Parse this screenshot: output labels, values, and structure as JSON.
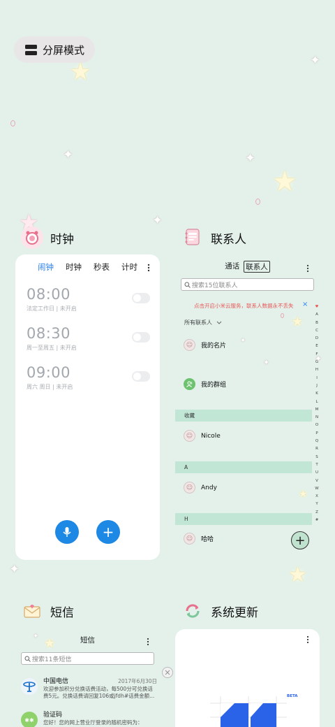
{
  "split_screen": {
    "label": "分屏模式"
  },
  "clock": {
    "app_title": "时钟",
    "tabs": [
      "闹钟",
      "时钟",
      "秒表",
      "计时"
    ],
    "alarms": [
      {
        "time": "08:00",
        "sub": "法定工作日 | 未开启"
      },
      {
        "time": "08:30",
        "sub": "周一至周五 | 未开启"
      },
      {
        "time": "09:00",
        "sub": "周六 周日 | 未开启"
      }
    ],
    "add_symbol": "+"
  },
  "contacts": {
    "app_title": "联系人",
    "tabs": [
      "通话",
      "联系人"
    ],
    "search_placeholder": "搜索15位联系人",
    "cloud_notice": "点击开启小米云服务，联系人数据永不丢失",
    "close_symbol": "×",
    "filter_label": "所有联系人",
    "my_card": "我的名片",
    "my_groups": "我的群组",
    "sections": [
      {
        "header": "收藏",
        "name": "Nicole"
      },
      {
        "header": "A",
        "name": "Andy"
      },
      {
        "header": "H",
        "name": "哈哈"
      }
    ],
    "alphabet": [
      "♥",
      "A",
      "B",
      "C",
      "D",
      "E",
      "F",
      "G",
      "H",
      "I",
      "J",
      "K",
      "L",
      "M",
      "N",
      "O",
      "P",
      "Q",
      "R",
      "S",
      "T",
      "U",
      "V",
      "W",
      "X",
      "Y",
      "Z",
      "#"
    ],
    "add_symbol": "+"
  },
  "sms": {
    "app_title": "短信",
    "header_title": "短信",
    "search_placeholder": "搜索11条短信",
    "messages": [
      {
        "sender": "中国电信",
        "date": "2017年6月30日",
        "line1": "欢迎参加积分兑换话费活动，每500分可兑换话",
        "line2": "费5元。兑换话费请回复106或jfdh#话费金额..."
      },
      {
        "sender": "验证码",
        "date": "",
        "line1": "您好！您的网上营业厅登录的随机密码为：",
        "line2": ""
      }
    ]
  },
  "update": {
    "app_title": "系统更新",
    "beta_badge": "BETA"
  },
  "colors": {
    "background": "#e3f1ea",
    "accent_blue": "#2f83f5",
    "section_green": "#c2e6d6",
    "notice_red": "#e85a5a"
  }
}
